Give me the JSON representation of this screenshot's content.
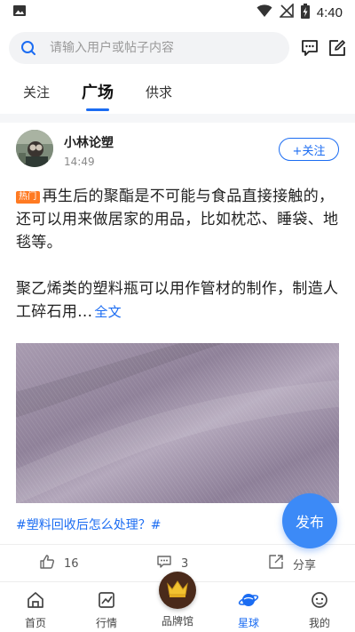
{
  "status_bar": {
    "time": "4:40"
  },
  "search": {
    "placeholder": "请输入用户或帖子内容"
  },
  "tabs": [
    {
      "label": "关注"
    },
    {
      "label": "广场"
    },
    {
      "label": "供求"
    }
  ],
  "post": {
    "author": "小林论塑",
    "time": "14:49",
    "follow_label": "+关注",
    "hot_badge": "热门",
    "text_p1": "再生后的聚酯是不可能与食品直接接触的，还可以用来做居家的用品，比如枕芯、睡袋、地毯等。",
    "text_p2": "聚乙烯类的塑料瓶可以用作管材的制作，制造人工碎石用...",
    "full_text_link": "全文",
    "topic": "#塑料回收后怎么处理？#",
    "likes": "16",
    "comments": "3",
    "share_label": "分享"
  },
  "fab_label": "发布",
  "bottom_nav": [
    {
      "label": "首页"
    },
    {
      "label": "行情"
    },
    {
      "label": "品牌馆"
    },
    {
      "label": "星球"
    },
    {
      "label": "我的"
    }
  ],
  "colors": {
    "accent": "#1b6cf2",
    "hot": "#ff7a22",
    "fab": "#3c8af7"
  }
}
